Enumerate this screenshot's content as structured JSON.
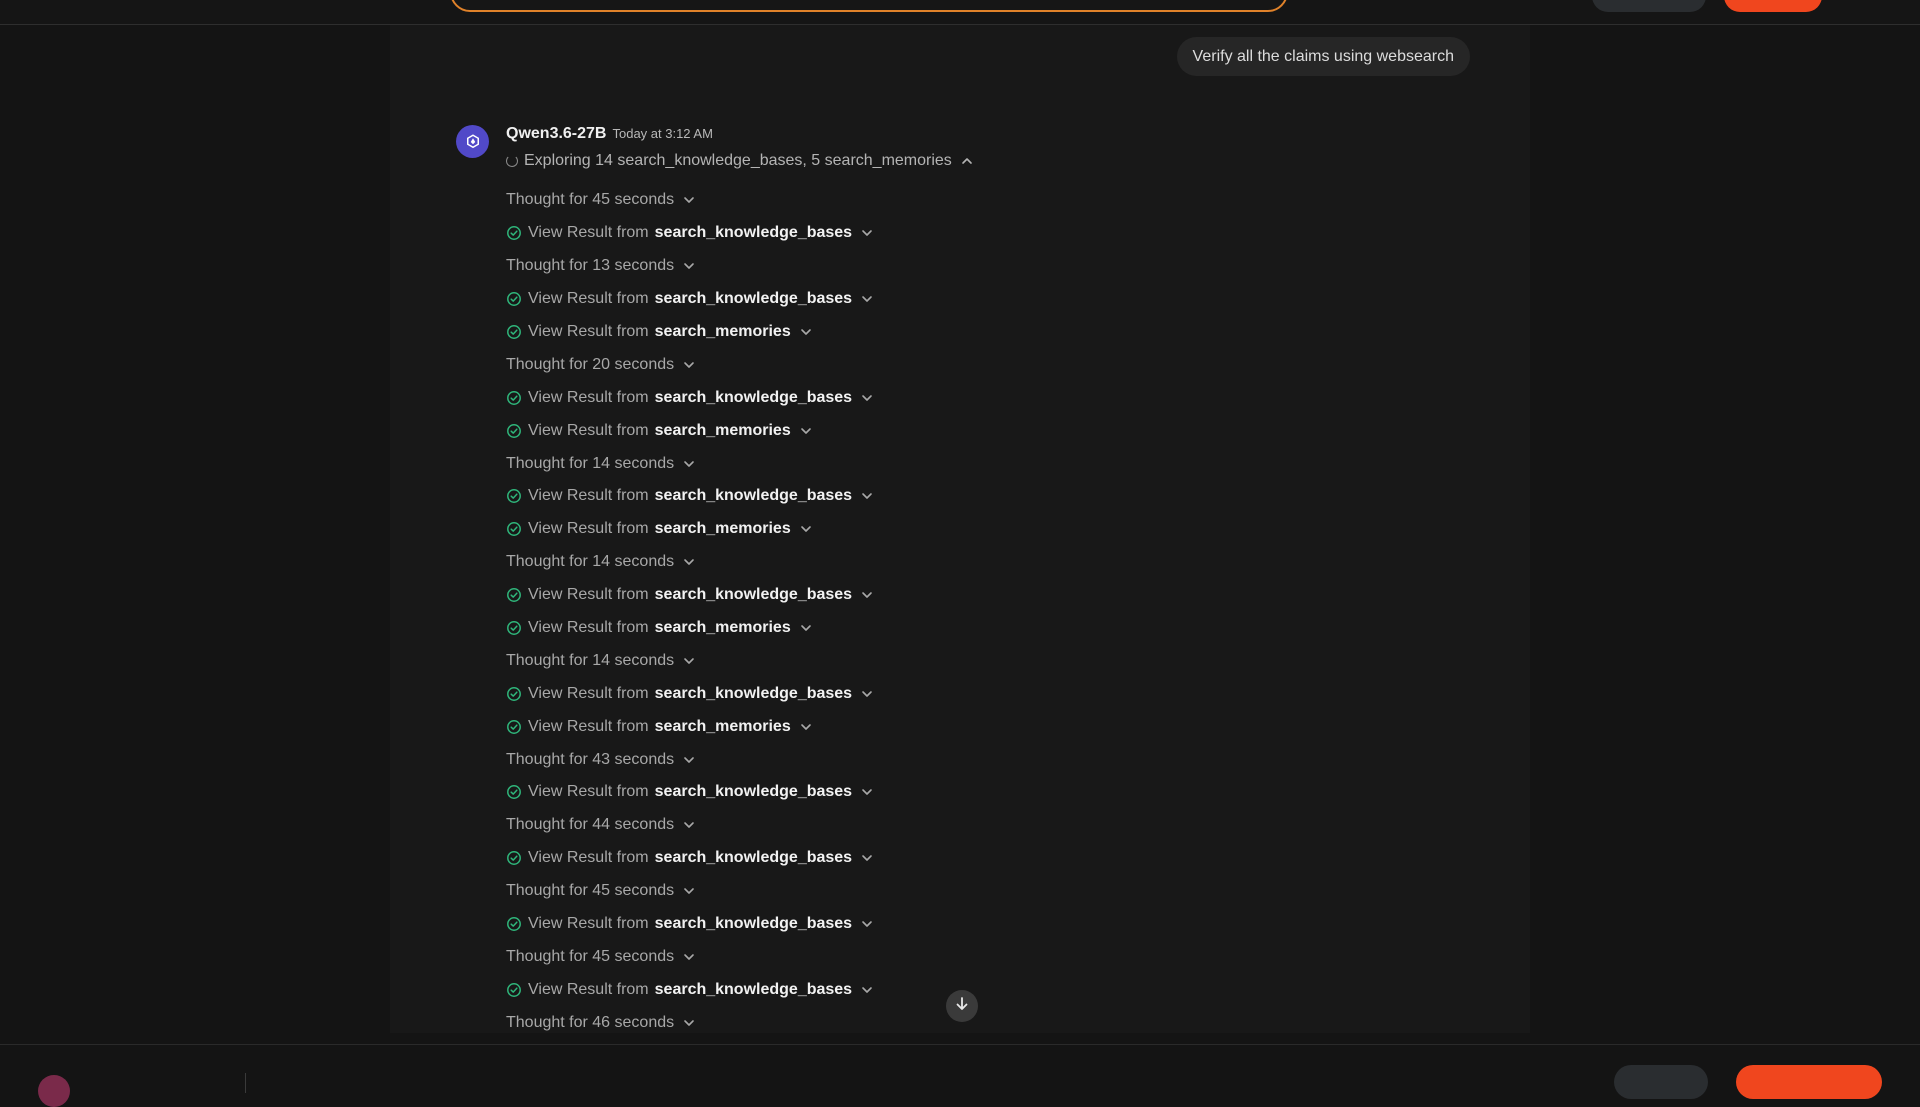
{
  "user_message": "Verify all the claims using websearch",
  "assistant": {
    "model_name": "Qwen3.6-27B",
    "timestamp": "Today at 3:12 AM",
    "exploring_text": "Exploring 14 search_knowledge_bases, 5 search_memories",
    "view_result_prefix": "View Result from",
    "steps": [
      {
        "type": "thought",
        "text": "Thought for 45 seconds"
      },
      {
        "type": "result",
        "tool": "search_knowledge_bases"
      },
      {
        "type": "thought",
        "text": "Thought for 13 seconds"
      },
      {
        "type": "result",
        "tool": "search_knowledge_bases"
      },
      {
        "type": "result",
        "tool": "search_memories"
      },
      {
        "type": "thought",
        "text": "Thought for 20 seconds"
      },
      {
        "type": "result",
        "tool": "search_knowledge_bases"
      },
      {
        "type": "result",
        "tool": "search_memories"
      },
      {
        "type": "thought",
        "text": "Thought for 14 seconds"
      },
      {
        "type": "result",
        "tool": "search_knowledge_bases"
      },
      {
        "type": "result",
        "tool": "search_memories"
      },
      {
        "type": "thought",
        "text": "Thought for 14 seconds"
      },
      {
        "type": "result",
        "tool": "search_knowledge_bases"
      },
      {
        "type": "result",
        "tool": "search_memories"
      },
      {
        "type": "thought",
        "text": "Thought for 14 seconds"
      },
      {
        "type": "result",
        "tool": "search_knowledge_bases"
      },
      {
        "type": "result",
        "tool": "search_memories"
      },
      {
        "type": "thought",
        "text": "Thought for 43 seconds"
      },
      {
        "type": "result",
        "tool": "search_knowledge_bases"
      },
      {
        "type": "thought",
        "text": "Thought for 44 seconds"
      },
      {
        "type": "result",
        "tool": "search_knowledge_bases"
      },
      {
        "type": "thought",
        "text": "Thought for 45 seconds"
      },
      {
        "type": "result",
        "tool": "search_knowledge_bases"
      },
      {
        "type": "thought",
        "text": "Thought for 45 seconds"
      },
      {
        "type": "result",
        "tool": "search_knowledge_bases"
      },
      {
        "type": "thought",
        "text": "Thought for 46 seconds"
      }
    ]
  },
  "icons": {
    "avatar": "qwen-logo-icon",
    "result_status": "check-circle-icon",
    "expand": "chevron-down-icon",
    "collapse": "chevron-up-icon",
    "scroll": "arrow-down-icon",
    "loading": "spinner-icon"
  },
  "colors": {
    "background": "#141414",
    "panel": "#181818",
    "accent": "#f0461e",
    "success": "#2fb57a",
    "avatar": "#5149c8"
  }
}
